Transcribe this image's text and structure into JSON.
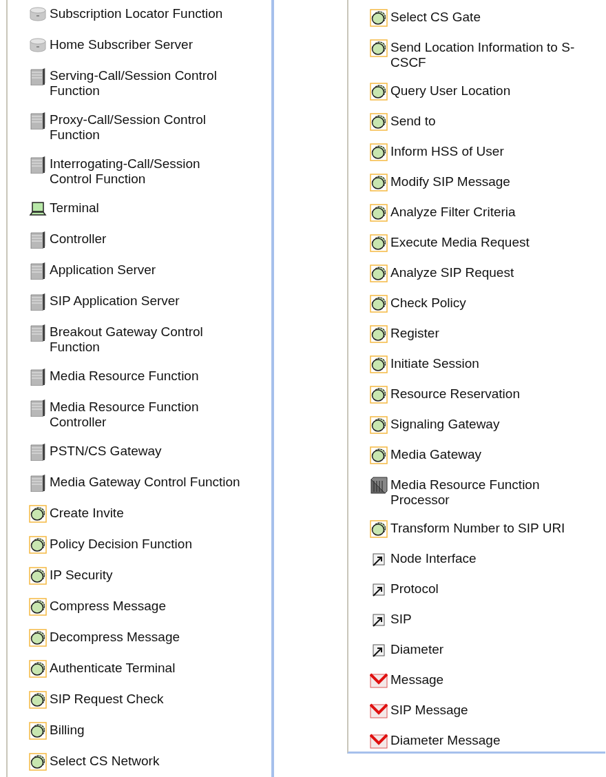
{
  "panels": [
    {
      "items": [
        {
          "kind": "database",
          "lines": [
            "Subscription Locator Function"
          ]
        },
        {
          "kind": "database",
          "lines": [
            "Home Subscriber Server"
          ]
        },
        {
          "kind": "server",
          "lines": [
            "Serving-Call/Session Control",
            "Function"
          ]
        },
        {
          "kind": "server",
          "lines": [
            "Proxy-Call/Session Control",
            "Function"
          ]
        },
        {
          "kind": "server",
          "lines": [
            "Interrogating-Call/Session",
            "Control Function"
          ]
        },
        {
          "kind": "terminal",
          "lines": [
            "Terminal"
          ]
        },
        {
          "kind": "server",
          "lines": [
            "Controller"
          ]
        },
        {
          "kind": "server",
          "lines": [
            "Application Server"
          ]
        },
        {
          "kind": "server",
          "lines": [
            "SIP Application Server"
          ]
        },
        {
          "kind": "server",
          "lines": [
            "Breakout Gateway Control",
            "Function"
          ]
        },
        {
          "kind": "server",
          "lines": [
            "Media Resource Function"
          ]
        },
        {
          "kind": "server",
          "lines": [
            "Media Resource Function",
            "Controller"
          ]
        },
        {
          "kind": "server",
          "lines": [
            "PSTN/CS Gateway"
          ]
        },
        {
          "kind": "server",
          "lines": [
            "Media Gateway Control Function"
          ]
        },
        {
          "kind": "function",
          "lines": [
            "Create Invite"
          ]
        },
        {
          "kind": "function",
          "lines": [
            "Policy Decision Function"
          ]
        },
        {
          "kind": "function",
          "lines": [
            "IP Security"
          ]
        },
        {
          "kind": "function",
          "lines": [
            "Compress Message"
          ]
        },
        {
          "kind": "function",
          "lines": [
            "Decompress Message"
          ]
        },
        {
          "kind": "function",
          "lines": [
            "Authenticate Terminal"
          ]
        },
        {
          "kind": "function",
          "lines": [
            "SIP Request Check"
          ]
        },
        {
          "kind": "function",
          "lines": [
            "Billing"
          ]
        },
        {
          "kind": "function",
          "lines": [
            "Select CS Network"
          ]
        }
      ]
    },
    {
      "items": [
        {
          "kind": "function",
          "lines": [
            "Select CS Gate"
          ]
        },
        {
          "kind": "function",
          "lines": [
            "Send Location Information to S-",
            "CSCF"
          ]
        },
        {
          "kind": "function",
          "lines": [
            "Query User Location"
          ]
        },
        {
          "kind": "function",
          "lines": [
            "Send to"
          ]
        },
        {
          "kind": "function",
          "lines": [
            "Inform HSS of User"
          ]
        },
        {
          "kind": "function",
          "lines": [
            "Modify SIP Message"
          ]
        },
        {
          "kind": "function",
          "lines": [
            "Analyze Filter Criteria"
          ]
        },
        {
          "kind": "function",
          "lines": [
            "Execute Media Request"
          ]
        },
        {
          "kind": "function",
          "lines": [
            "Analyze SIP Request"
          ]
        },
        {
          "kind": "function",
          "lines": [
            "Check Policy"
          ]
        },
        {
          "kind": "function",
          "lines": [
            "Register"
          ]
        },
        {
          "kind": "function",
          "lines": [
            "Initiate Session"
          ]
        },
        {
          "kind": "function",
          "lines": [
            "Resource Reservation"
          ]
        },
        {
          "kind": "function",
          "lines": [
            "Signaling Gateway"
          ]
        },
        {
          "kind": "function",
          "lines": [
            "Media Gateway"
          ]
        },
        {
          "kind": "processor",
          "lines": [
            "Media Resource Function",
            "Processor"
          ]
        },
        {
          "kind": "function",
          "lines": [
            "Transform Number to SIP URI"
          ]
        },
        {
          "kind": "interface",
          "lines": [
            "Node Interface"
          ]
        },
        {
          "kind": "interface",
          "lines": [
            "Protocol"
          ]
        },
        {
          "kind": "interface",
          "lines": [
            "SIP"
          ]
        },
        {
          "kind": "interface",
          "lines": [
            "Diameter"
          ]
        },
        {
          "kind": "message",
          "lines": [
            "Message"
          ]
        },
        {
          "kind": "message",
          "lines": [
            "SIP Message"
          ]
        },
        {
          "kind": "message",
          "lines": [
            "Diameter Message"
          ]
        }
      ]
    }
  ]
}
